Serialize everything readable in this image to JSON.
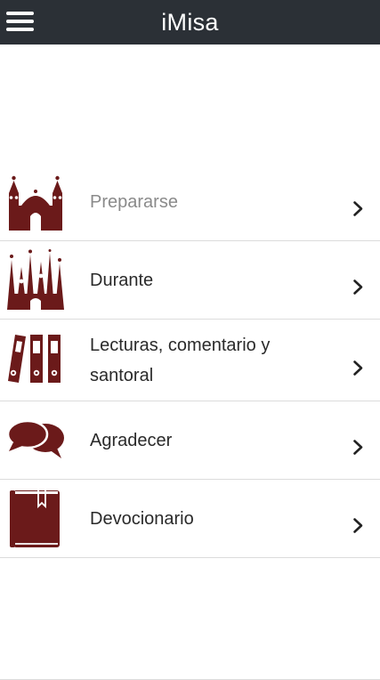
{
  "header": {
    "title": "iMisa",
    "background_color": "#2b3036",
    "menu_icon": "hamburger-menu-icon"
  },
  "accent_color": "#6b1a1a",
  "menu": {
    "items": [
      {
        "label": "Prepararse",
        "icon": "church-facade-icon",
        "muted": true
      },
      {
        "label": "Durante",
        "icon": "cathedral-spires-icon",
        "muted": false
      },
      {
        "label_line1": "Lecturas, comentario y",
        "label_line2": "santoral",
        "icon": "binders-icon",
        "muted": false
      },
      {
        "label": "Agradecer",
        "icon": "speech-bubbles-icon",
        "muted": false
      },
      {
        "label": "Devocionario",
        "icon": "prayer-book-icon",
        "muted": false
      }
    ],
    "chevron_icon": "chevron-right-icon"
  }
}
